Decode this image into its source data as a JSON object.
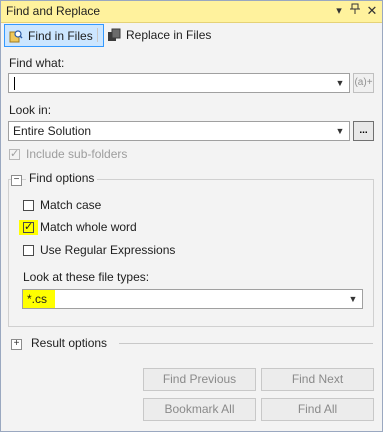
{
  "window": {
    "title": "Find and Replace"
  },
  "tabs": [
    {
      "label": "Find in Files",
      "active": true
    },
    {
      "label": "Replace in Files",
      "active": false
    }
  ],
  "find_what": {
    "label": "Find what:",
    "value": "",
    "side_button": "(a)+"
  },
  "look_in": {
    "label": "Look in:",
    "value": "Entire Solution",
    "browse_label": "..."
  },
  "include_subfolders": {
    "label": "Include sub-folders",
    "checked": true,
    "enabled": false
  },
  "find_options": {
    "title": "Find options",
    "expanded": true,
    "match_case": {
      "label": "Match case",
      "checked": false
    },
    "match_whole_word": {
      "label": "Match whole word",
      "checked": true
    },
    "use_regex": {
      "label": "Use Regular Expressions",
      "checked": false
    },
    "file_types": {
      "label": "Look at these file types:",
      "value": "*.cs"
    }
  },
  "result_options": {
    "title": "Result options",
    "expanded": false
  },
  "buttons": {
    "find_previous": "Find Previous",
    "find_next": "Find Next",
    "bookmark_all": "Bookmark All",
    "find_all": "Find All"
  },
  "colors": {
    "titlebar": "#fff29d",
    "highlight": "#ffff00",
    "active_tab": "#cce6ff"
  }
}
